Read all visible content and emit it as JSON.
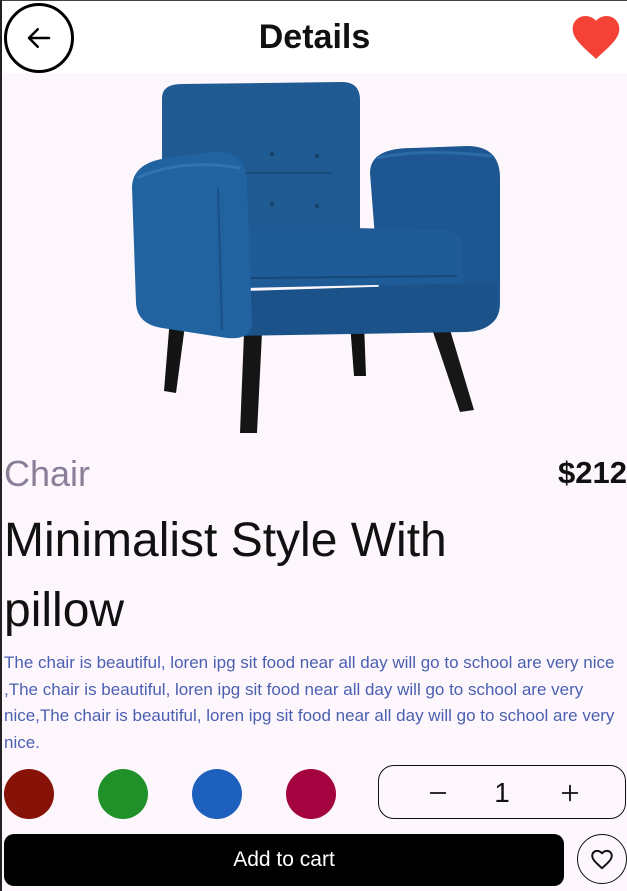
{
  "header": {
    "title": "Details",
    "back_icon": "arrow-left-icon",
    "favorite_icon": "heart-filled-icon",
    "favorite_color": "#f44336"
  },
  "product": {
    "image_alt": "blue armchair",
    "category": "Chair",
    "price": "$212",
    "name": "Minimalist Style With pillow",
    "description": "The chair is beautiful, loren ipg sit food near all day will go to school are very nice ,The chair is beautiful, loren ipg sit food near all day will go to school are very nice,The chair is beautiful, loren ipg sit food near all day will go to school are very nice.",
    "colors": [
      "#861208",
      "#1f9128",
      "#1c5fbd",
      "#a3033f"
    ]
  },
  "quantity": {
    "value": "1",
    "minus_icon": "minus-icon",
    "plus_icon": "plus-icon"
  },
  "actions": {
    "add_to_cart_label": "Add to cart",
    "wishlist_icon": "heart-outline-icon"
  }
}
